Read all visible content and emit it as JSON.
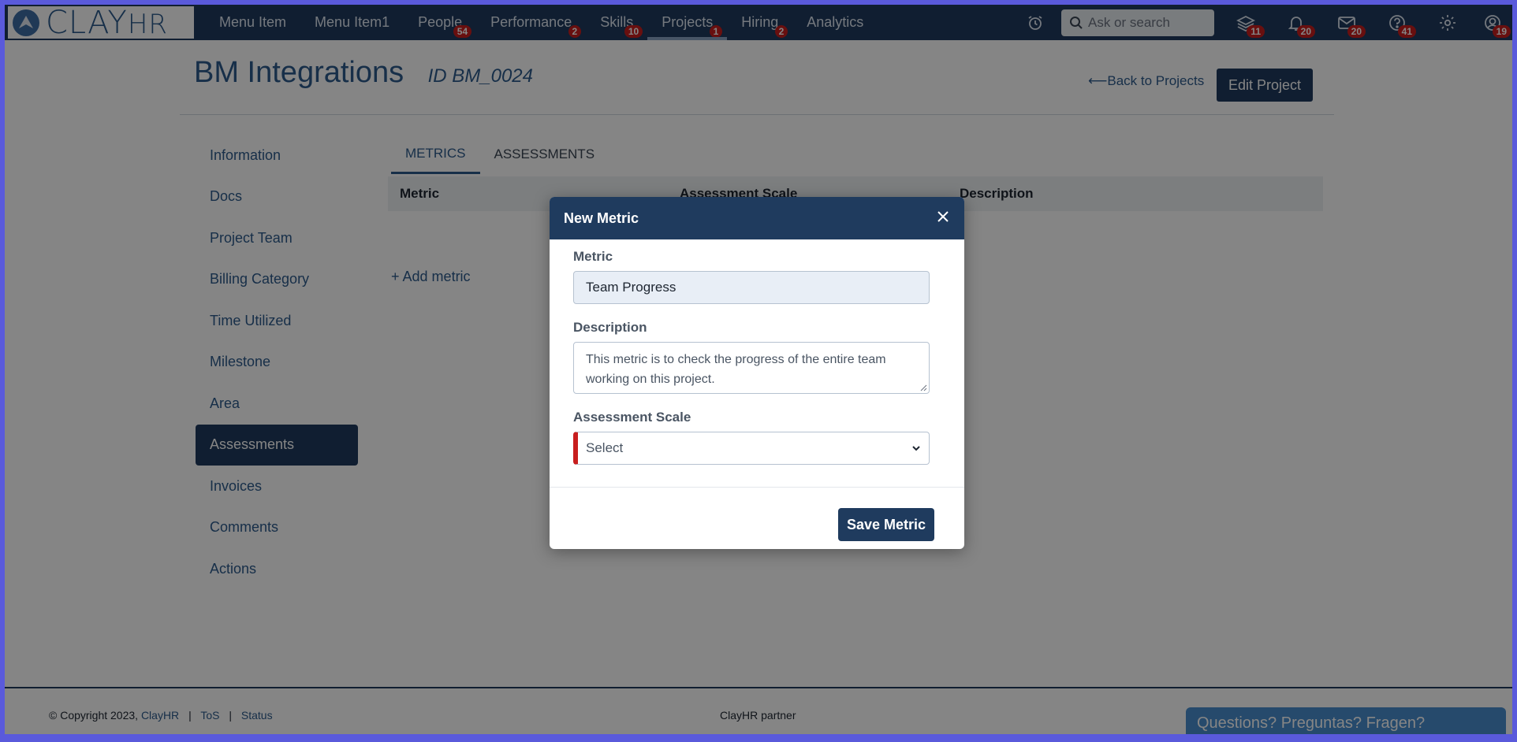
{
  "app": {
    "logo_text": "CLAY",
    "logo_suffix": "HR"
  },
  "nav": {
    "items": [
      {
        "label": "Menu Item",
        "badge": ""
      },
      {
        "label": "Menu Item1",
        "badge": ""
      },
      {
        "label": "People",
        "badge": "54"
      },
      {
        "label": "Performance",
        "badge": "2"
      },
      {
        "label": "Skills",
        "badge": "10"
      },
      {
        "label": "Projects",
        "badge": "1"
      },
      {
        "label": "Hiring",
        "badge": "2"
      },
      {
        "label": "Analytics",
        "badge": ""
      }
    ],
    "search_placeholder": "Ask or search",
    "icons": [
      {
        "name": "alarm-icon",
        "badge": ""
      },
      {
        "name": "stack-icon",
        "badge": "11"
      },
      {
        "name": "bell-icon",
        "badge": "20"
      },
      {
        "name": "mail-icon",
        "badge": "20"
      },
      {
        "name": "help-icon",
        "badge": "41"
      },
      {
        "name": "gear-icon",
        "badge": ""
      },
      {
        "name": "user-icon",
        "badge": "19"
      }
    ]
  },
  "header": {
    "title": "BM Integrations",
    "id_label": "ID BM_0024",
    "back_link": "Back to Projects",
    "edit_button": "Edit Project"
  },
  "sidebar": {
    "items": [
      "Information",
      "Docs",
      "Project Team",
      "Billing Category",
      "Time Utilized",
      "Milestone",
      "Area",
      "Assessments",
      "Invoices",
      "Comments",
      "Actions"
    ],
    "active": "Assessments"
  },
  "tabs": [
    {
      "label": "METRICS",
      "active": true
    },
    {
      "label": "ASSESSMENTS",
      "active": false
    }
  ],
  "table": {
    "columns": [
      "Metric",
      "Assessment Scale",
      "Description"
    ]
  },
  "add_metric": "Add metric",
  "modal": {
    "title": "New Metric",
    "metric_label": "Metric",
    "metric_value": "Team Progress",
    "description_label": "Description",
    "description_value": "This metric is to check the progress of the entire team working on this project.",
    "scale_label": "Assessment Scale",
    "scale_value": "Select",
    "save_button": "Save Metric"
  },
  "footer": {
    "copyright": "© Copyright 2023,",
    "brand_link": "ClayHR",
    "tos": "ToS",
    "status": "Status",
    "separator": "|",
    "center": "ClayHR partner",
    "help": "Questions? Preguntas? Fragen?"
  },
  "colors": {
    "nav_bg": "#1f3b5e",
    "accent": "#2d5b8c",
    "badge": "#c81e1e",
    "help_tab": "#4a8fd0"
  }
}
